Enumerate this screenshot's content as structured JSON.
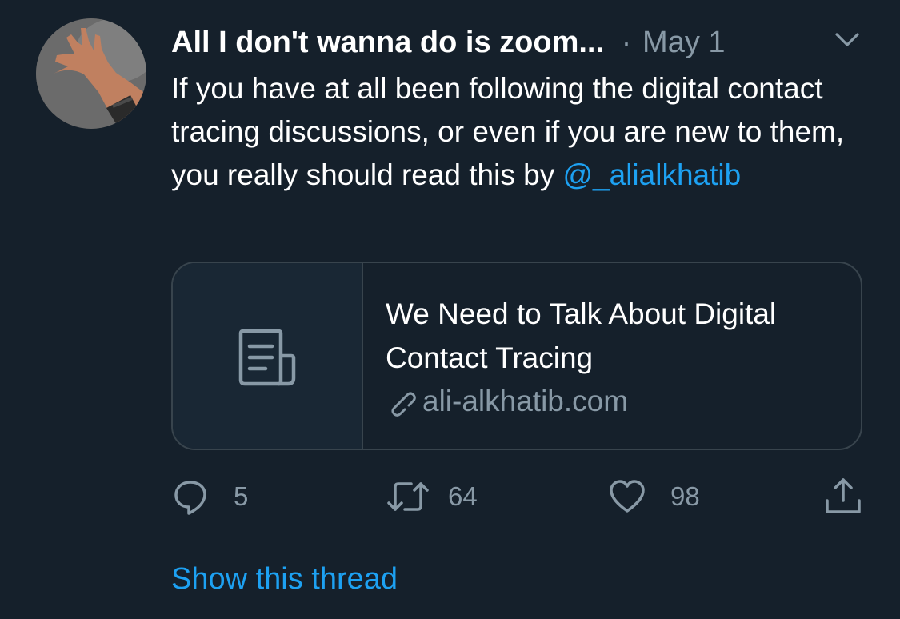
{
  "tweet": {
    "display_name": "All I don't wanna do is zoom...",
    "separator": "·",
    "date": "May 1",
    "text_before_mention": "If you have at all been following the digital contact tracing discussions, or even if you are new to them, you really should read this by ",
    "mention": "@_alialkhatib",
    "card": {
      "title": "We Need to Talk About Digital Contact Tracing",
      "domain": "ali-alkhatib.com",
      "media_icon": "article-icon",
      "domain_icon": "link-icon"
    },
    "actions": {
      "reply": {
        "icon": "reply-icon",
        "count": "5"
      },
      "retweet": {
        "icon": "retweet-icon",
        "count": "64"
      },
      "like": {
        "icon": "heart-icon",
        "count": "98"
      },
      "share": {
        "icon": "share-icon"
      }
    },
    "show_thread": "Show this thread"
  },
  "colors": {
    "background": "#15202b",
    "text": "#ffffff",
    "secondary": "#8899a6",
    "accent": "#1da1f2",
    "border": "#38444d"
  }
}
